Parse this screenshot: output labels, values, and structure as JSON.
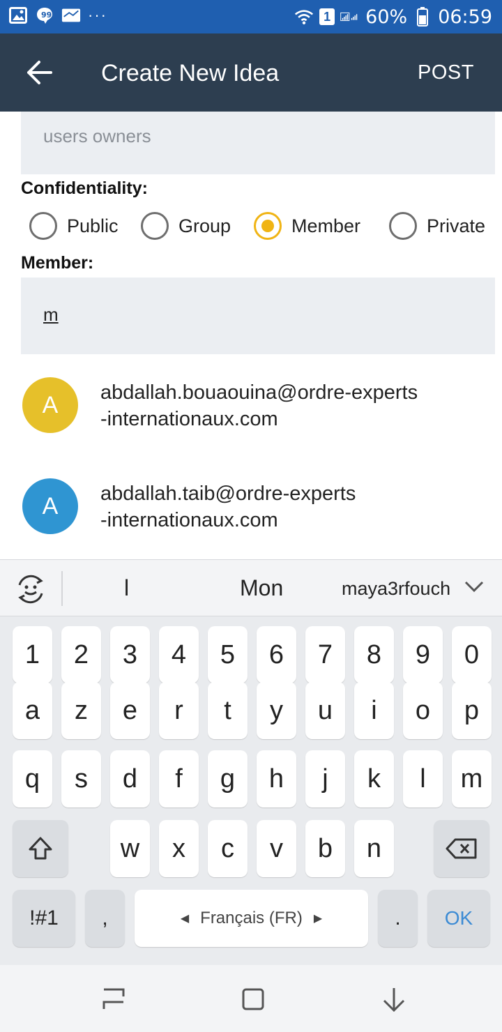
{
  "status_bar": {
    "battery_percent": "60%",
    "time": "06:59",
    "sim_slot": "1",
    "overflow": "···",
    "icons": [
      "gallery-icon",
      "chat-bubble-icon",
      "app-icon",
      "wifi-icon",
      "signal-icon",
      "battery-icon"
    ]
  },
  "app_bar": {
    "title": "Create New Idea",
    "action": "POST",
    "background": "#2d3e50"
  },
  "form": {
    "owners_placeholder": "users owners",
    "confidentiality_label": "Confidentiality:",
    "options": [
      {
        "label": "Public",
        "selected": false
      },
      {
        "label": "Group",
        "selected": false
      },
      {
        "label": "Member",
        "selected": true
      },
      {
        "label": "Private",
        "selected": false
      }
    ],
    "member_label": "Member:",
    "member_value": "m",
    "accent": "#f0b414"
  },
  "suggestions": [
    {
      "initial": "A",
      "line1": "abdallah.bouaouina@ordre-experts",
      "line2": "-internationaux.com",
      "color": "#e6c02a"
    },
    {
      "initial": "A",
      "line1": "abdallah.taib@ordre-experts",
      "line2": "-internationaux.com",
      "color": "#2f95d2"
    }
  ],
  "keyboard": {
    "predictions": [
      "l",
      "Mon",
      "maya3rfouch"
    ],
    "rows": [
      [
        "1",
        "2",
        "3",
        "4",
        "5",
        "6",
        "7",
        "8",
        "9",
        "0"
      ],
      [
        "a",
        "z",
        "e",
        "r",
        "t",
        "y",
        "u",
        "i",
        "o",
        "p"
      ],
      [
        "q",
        "s",
        "d",
        "f",
        "g",
        "h",
        "j",
        "k",
        "l",
        "m"
      ],
      [
        "w",
        "x",
        "c",
        "v",
        "b",
        "n"
      ]
    ],
    "symbols_key": "!#1",
    "comma_key": ",",
    "space_label": "Français (FR)",
    "period_key": ".",
    "ok_key": "OK",
    "ok_color": "#3c8bd4"
  },
  "nav_bar": {
    "buttons": [
      "recent-apps-icon",
      "home-icon",
      "back-down-icon"
    ]
  }
}
